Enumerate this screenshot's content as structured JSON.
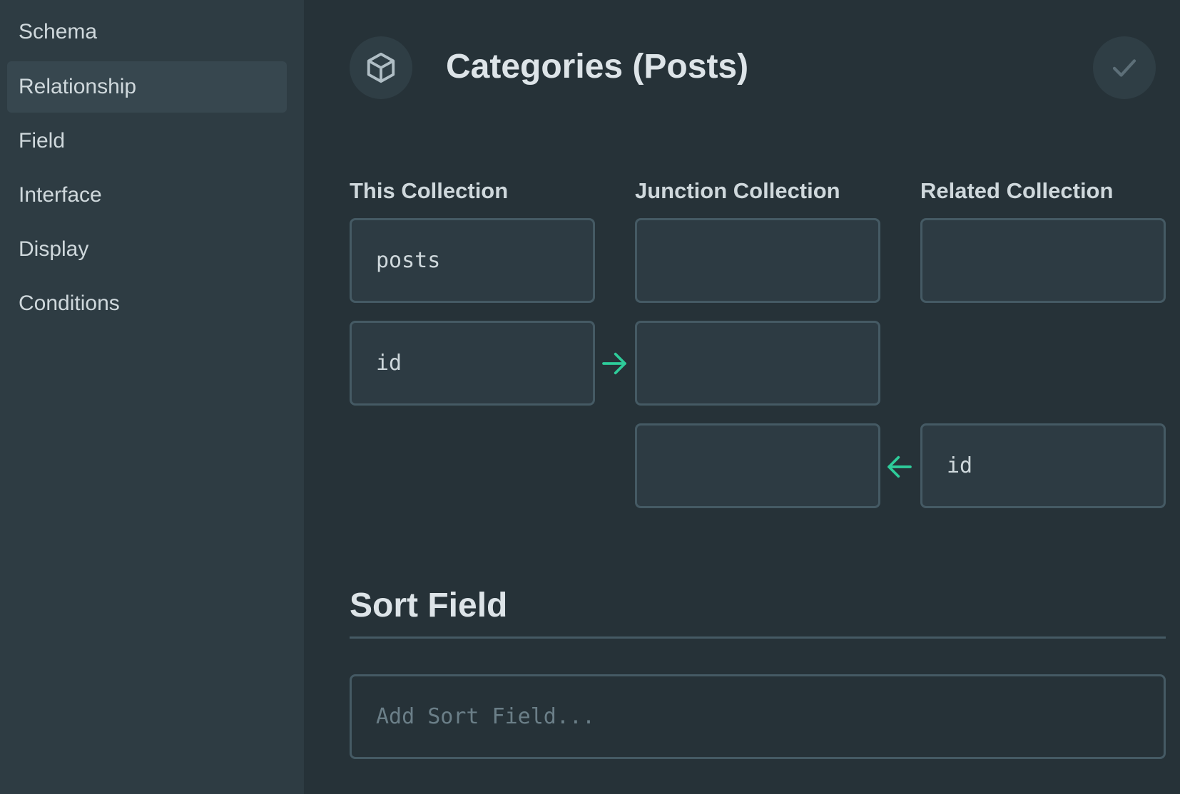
{
  "sidebar": {
    "items": [
      {
        "label": "Schema",
        "active": false
      },
      {
        "label": "Relationship",
        "active": true
      },
      {
        "label": "Field",
        "active": false
      },
      {
        "label": "Interface",
        "active": false
      },
      {
        "label": "Display",
        "active": false
      },
      {
        "label": "Conditions",
        "active": false
      }
    ]
  },
  "header": {
    "icon": "box-icon",
    "title": "Categories (Posts)",
    "save_icon": "check-icon"
  },
  "relationship": {
    "columns": {
      "this": "This Collection",
      "junction": "Junction Collection",
      "related": "Related Collection"
    },
    "this_collection": "posts",
    "this_field": "id",
    "junction_collection": "",
    "junction_field_this": "",
    "junction_field_related": "",
    "related_collection": "",
    "related_field": "id"
  },
  "sort": {
    "title": "Sort Field",
    "placeholder": "Add Sort Field..."
  },
  "colors": {
    "accent": "#2ecc9a",
    "background": "#263238",
    "sidebar": "#2e3c43",
    "border": "#455a64"
  }
}
